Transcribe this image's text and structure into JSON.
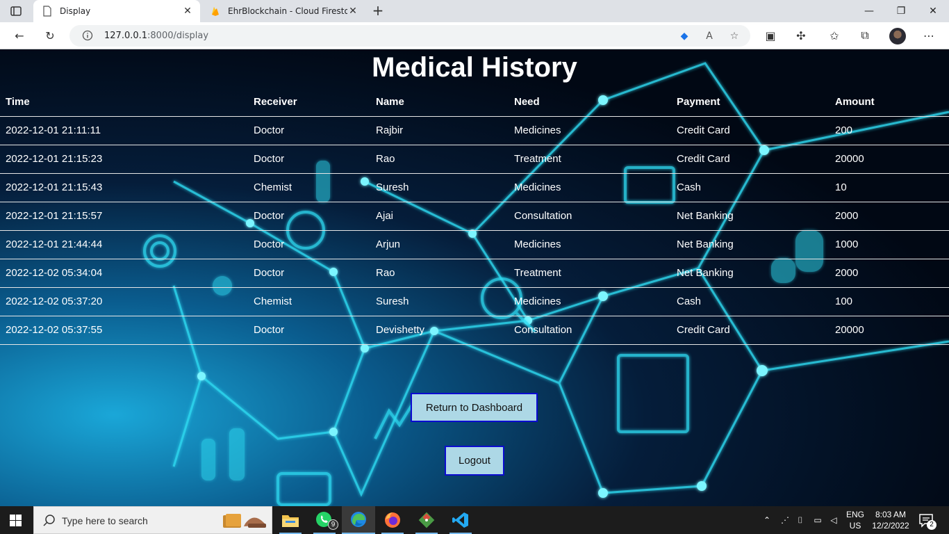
{
  "browser": {
    "tabs": [
      {
        "title": "Display",
        "active": true
      },
      {
        "title": "EhrBlockchain - Cloud Firestore -",
        "active": false
      }
    ],
    "url_host": "127.0.0.1",
    "url_path": ":8000/display",
    "window_controls": [
      "minimize-icon",
      "restore-icon",
      "close-icon"
    ]
  },
  "page": {
    "title": "Medical History",
    "table": {
      "headers": [
        "Time",
        "Receiver",
        "Name",
        "Need",
        "Payment",
        "Amount"
      ],
      "rows": [
        [
          "2022-12-01 21:11:11",
          "Doctor",
          "Rajbir",
          "Medicines",
          "Credit Card",
          "200"
        ],
        [
          "2022-12-01 21:15:23",
          "Doctor",
          "Rao",
          "Treatment",
          "Credit Card",
          "20000"
        ],
        [
          "2022-12-01 21:15:43",
          "Chemist",
          "Suresh",
          "Medicines",
          "Cash",
          "10"
        ],
        [
          "2022-12-01 21:15:57",
          "Doctor",
          "Ajai",
          "Consultation",
          "Net Banking",
          "2000"
        ],
        [
          "2022-12-01 21:44:44",
          "Doctor",
          "Arjun",
          "Medicines",
          "Net Banking",
          "1000"
        ],
        [
          "2022-12-02 05:34:04",
          "Doctor",
          "Rao",
          "Treatment",
          "Net Banking",
          "2000"
        ],
        [
          "2022-12-02 05:37:20",
          "Chemist",
          "Suresh",
          "Medicines",
          "Cash",
          "100"
        ],
        [
          "2022-12-02 05:37:55",
          "Doctor",
          "Devishetty",
          "Consultation",
          "Credit Card",
          "20000"
        ]
      ]
    },
    "dashboard_button": "Return to Dashboard",
    "logout_button": "Logout"
  },
  "taskbar": {
    "search_placeholder": "Type here to search",
    "whatsapp_badge": "9",
    "language_line1": "ENG",
    "language_line2": "US",
    "time": "8:03 AM",
    "date": "12/2/2022",
    "notification_count": "2"
  },
  "colors": {
    "button_bg": "#add8e6",
    "button_border": "#0b0bd0",
    "accent": "#76b9ed"
  }
}
